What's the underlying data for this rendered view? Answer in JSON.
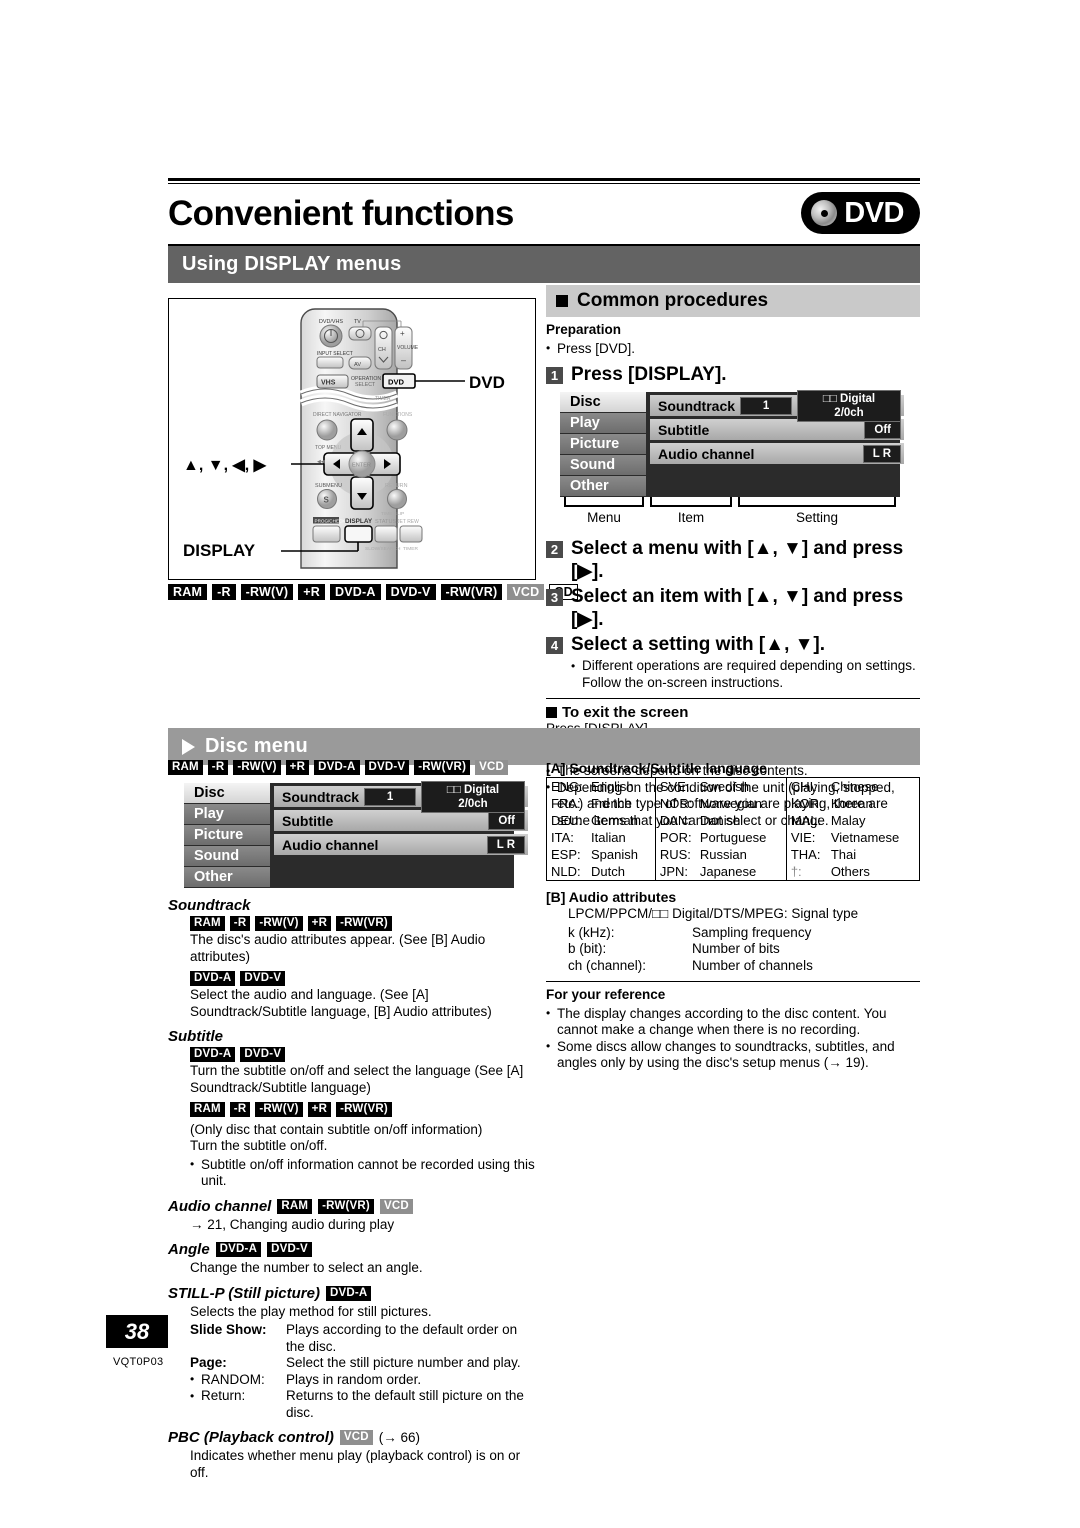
{
  "header": {
    "title": "Convenient functions",
    "badge_word": "DVD",
    "badge_icon": "dvd-disc-icon"
  },
  "section_display": {
    "title": "Using DISPLAY menus"
  },
  "remote": {
    "dvd_callout": "DVD",
    "arrows_callout": "▲, ▼, ◀, ▶",
    "display_callout": "DISPLAY",
    "labels": {
      "dvd_vhs": "DVD/VHS",
      "input_select": "INPUT SELECT",
      "tv": "TV",
      "ch": "CH",
      "volume": "VOLUME",
      "av": "AV",
      "vhs": "VHS",
      "operation_select": "OPERATION SELECT",
      "dvd_btn": "DVD",
      "direct_navigator": "DIRECT NAVIGATOR",
      "top_menu": "TOP MENU",
      "function": "FUNCTIONS",
      "enter": "ENTER",
      "submenu": "SUBMENU",
      "return": "RETURN",
      "s": "S",
      "program": "PROG/CHECK",
      "display": "DISPLAY",
      "status": "STATUS",
      "jet_rew": "TIME SLIP / JET REW",
      "plus": "+",
      "minus": "–"
    }
  },
  "disc_badges_display": [
    {
      "label": "RAM",
      "style": "black"
    },
    {
      "label": "-R",
      "style": "black"
    },
    {
      "label": "-RW(V)",
      "style": "black"
    },
    {
      "label": "+R",
      "style": "black"
    },
    {
      "label": "DVD-A",
      "style": "black"
    },
    {
      "label": "DVD-V",
      "style": "black"
    },
    {
      "label": "-RW(VR)",
      "style": "black"
    },
    {
      "label": "VCD",
      "style": "gray"
    },
    {
      "label": "CD",
      "style": "outline"
    }
  ],
  "common": {
    "heading": "Common procedures",
    "preparation_label": "Preparation",
    "preparation_text": "Press [DVD].",
    "step1": "Press [DISPLAY].",
    "step1_num": "1",
    "step2": "Select a menu with [▲, ▼] and press [▶].",
    "step2_num": "2",
    "step3": "Select an item with [▲, ▼] and press [▶].",
    "step3_num": "3",
    "step4": "Select a setting with [▲, ▼].",
    "step4_num": "4",
    "step4_note": "Different operations are required depending on settings. Follow the on-screen instructions.",
    "exit_heading": "To exit the screen",
    "exit_text": "Press [DISPLAY].",
    "reference_label": "For your reference",
    "reference_1": "The screens depend on the disc contents.",
    "reference_2": "Depending on the condition of the unit (playing, stopped, etc.) and the type of software you are playing, there are some items that you cannot select or change.",
    "bracket_menu": "Menu",
    "bracket_item": "Item",
    "bracket_setting": "Setting"
  },
  "osd": {
    "menu_items": [
      "Disc",
      "Play",
      "Picture",
      "Sound",
      "Other"
    ],
    "selected_menu": "Disc",
    "rows": [
      {
        "name": "Soundtrack",
        "value_num": "1",
        "value": "□□ Digital  2/0ch"
      },
      {
        "name": "Subtitle",
        "value": "Off"
      },
      {
        "name": "Audio channel",
        "value": "L R"
      }
    ]
  },
  "section_disc_menu": {
    "title": "Disc menu"
  },
  "disc_badges_discmenu": [
    {
      "label": "RAM",
      "style": "black"
    },
    {
      "label": "-R",
      "style": "black"
    },
    {
      "label": "-RW(V)",
      "style": "black"
    },
    {
      "label": "+R",
      "style": "black"
    },
    {
      "label": "DVD-A",
      "style": "black"
    },
    {
      "label": "DVD-V",
      "style": "black"
    },
    {
      "label": "-RW(VR)",
      "style": "black"
    },
    {
      "label": "VCD",
      "style": "gray"
    }
  ],
  "soundtrack": {
    "heading": "Soundtrack",
    "badges_1": [
      "RAM",
      "-R",
      "-RW(V)",
      "+R",
      "-RW(VR)"
    ],
    "text_1": "The disc's audio attributes appear. (See [B] Audio attributes)",
    "badges_2": [
      "DVD-A",
      "DVD-V"
    ],
    "text_2": "Select the audio and language. (See [A] Soundtrack/Subtitle language, [B] Audio attributes)"
  },
  "subtitle": {
    "heading": "Subtitle",
    "badges_1": [
      "DVD-A",
      "DVD-V"
    ],
    "text_1": "Turn the subtitle on/off and select the language (See [A] Soundtrack/Subtitle language)",
    "badges_2": [
      "RAM",
      "-R",
      "-RW(V)",
      "+R",
      "-RW(VR)"
    ],
    "text_2_inline": "(Only disc that contain subtitle on/off information)",
    "text_3": "Turn the subtitle on/off.",
    "bullet_1": "Subtitle on/off information cannot be recorded using this unit."
  },
  "audio_channel": {
    "heading": "Audio channel",
    "badges": [
      {
        "label": "RAM",
        "style": "black"
      },
      {
        "label": "-RW(VR)",
        "style": "black"
      },
      {
        "label": "VCD",
        "style": "gray"
      }
    ],
    "text": "→ 21, Changing audio during play"
  },
  "angle": {
    "heading": "Angle",
    "badges": [
      "DVD-A",
      "DVD-V"
    ],
    "text": "Change the number to select an angle."
  },
  "still_p": {
    "heading": "STILL-P (Still picture)",
    "badges": [
      "DVD-A"
    ],
    "text": "Selects the play method for still pictures.",
    "rows": [
      {
        "key": "Slide Show:",
        "val": "Plays according to the default order on the disc.",
        "bold": true
      },
      {
        "key": "Page:",
        "val": "Select the still picture number and play.",
        "bold": true
      }
    ],
    "bullets": [
      {
        "key": "RANDOM:",
        "val": "Plays in random order."
      },
      {
        "key": "Return:",
        "val": "Returns to the default still picture on the disc."
      }
    ]
  },
  "pbc": {
    "heading": "PBC (Playback control)",
    "badges": [
      {
        "label": "VCD",
        "style": "gray"
      }
    ],
    "ref": "(→ 66)",
    "text": "Indicates whether menu play (playback control) is on or off."
  },
  "lang_table": {
    "heading": "[A] Soundtrack/Subtitle language",
    "col1": [
      {
        "code": "ENG:",
        "name": "English"
      },
      {
        "code": "FRA:",
        "name": "French"
      },
      {
        "code": "DEU:",
        "name": "German"
      },
      {
        "code": "ITA:",
        "name": "Italian"
      },
      {
        "code": "ESP:",
        "name": "Spanish"
      },
      {
        "code": "NLD:",
        "name": "Dutch"
      }
    ],
    "col2": [
      {
        "code": "SVE:",
        "name": "Swedish"
      },
      {
        "code": "NOR:",
        "name": "Norwegian"
      },
      {
        "code": "DAN:",
        "name": "Danish"
      },
      {
        "code": "POR:",
        "name": "Portuguese"
      },
      {
        "code": "RUS:",
        "name": "Russian"
      },
      {
        "code": "JPN:",
        "name": "Japanese"
      }
    ],
    "col3": [
      {
        "code": "CHI:",
        "name": "Chinese"
      },
      {
        "code": "KOR:",
        "name": "Korean"
      },
      {
        "code": "MAL:",
        "name": "Malay"
      },
      {
        "code": "VIE:",
        "name": "Vietnamese"
      },
      {
        "code": "THA:",
        "name": "Thai"
      },
      {
        "code": "†:",
        "name": "Others"
      }
    ]
  },
  "audio_attr": {
    "heading": "[B] Audio attributes",
    "signal_line": "LPCM/PPCM/□□ Digital/DTS/MPEG: Signal type",
    "rows": [
      {
        "key": "k (kHz):",
        "val": "Sampling frequency"
      },
      {
        "key": "b (bit):",
        "val": "Number of bits"
      },
      {
        "key": "ch (channel):",
        "val": "Number of channels"
      }
    ],
    "reference_label": "For your reference",
    "reference_1": "The display changes according to the disc content. You cannot make a change when there is no recording.",
    "reference_2": "Some discs allow changes to soundtracks, subtitles, and angles only by using the disc's setup menus (→ 19)."
  },
  "footer": {
    "page_number": "38",
    "doc_code": "VQT0P03"
  }
}
